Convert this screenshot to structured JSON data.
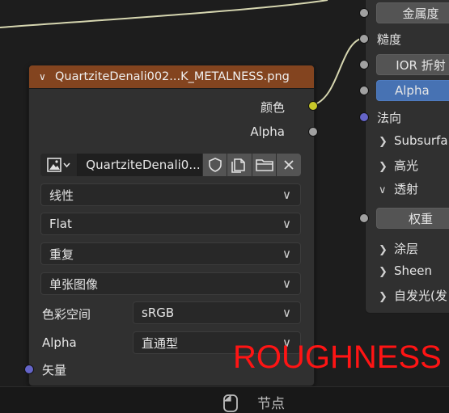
{
  "colors": {
    "background": "#1d1d1d",
    "node_body": "#303030",
    "image_node_header": "#83441f",
    "socket_color": "#c7c729",
    "socket_float": "#a1a1a1",
    "socket_vector": "#6464c8",
    "wire": "#d6d6b0",
    "alpha_button": "#4772b3",
    "annotation": "#ff1414"
  },
  "image_node": {
    "title": "QuartziteDenali002...K_METALNESS.png",
    "outputs": {
      "color": "颜色",
      "alpha": "Alpha"
    },
    "image_name": "QuartziteDenali0...",
    "icons": [
      "image-icon",
      "shield-icon",
      "duplicate-icon",
      "folder-icon",
      "close-icon"
    ],
    "interpolation": "线性",
    "projection": "Flat",
    "extension": "重复",
    "source": "单张图像",
    "colorspace_label": "色彩空间",
    "colorspace_value": "sRGB",
    "alpha_label": "Alpha",
    "alpha_value": "直通型",
    "vector_input": "矢量"
  },
  "principled_node": {
    "metallic_button": "金属度",
    "roughness_label": "糙度",
    "ior_button": "IOR 折射",
    "alpha_button": "Alpha",
    "normal_label": "法向",
    "sections_a": [
      "Subsurfa",
      "高光",
      "透射"
    ],
    "weight_button": "权重",
    "sections_b": [
      "涂层",
      "Sheen",
      "自发光(发"
    ]
  },
  "annotation": {
    "text": "ROUGHNESS"
  },
  "bottom_bar": {
    "label": "节点"
  }
}
